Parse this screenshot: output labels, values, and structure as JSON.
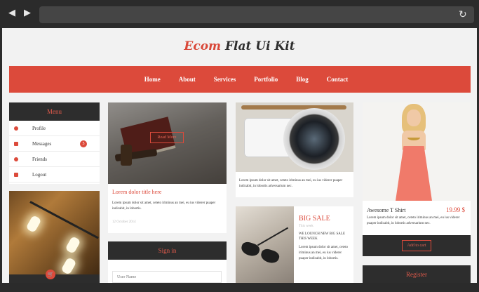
{
  "browser": {
    "back_icon": "◀",
    "forward_icon": "▶",
    "reload_icon": "↻"
  },
  "logo": {
    "accent": "Ecom",
    "rest": "Flat Ui Kit"
  },
  "nav": {
    "items": [
      "Home",
      "About",
      "Services",
      "Portfolio",
      "Blog",
      "Contact"
    ]
  },
  "menu": {
    "title": "Menu",
    "items": [
      {
        "label": "Profile",
        "icon": "user-icon"
      },
      {
        "label": "Messages",
        "icon": "envelope-icon",
        "badge": "5"
      },
      {
        "label": "Friends",
        "icon": "friends-icon"
      },
      {
        "label": "Logout",
        "icon": "logout-icon"
      }
    ]
  },
  "lamp_card": {
    "cart_icon": "🛒"
  },
  "blog_card": {
    "button": "Read More",
    "title": "Lorem dolor title here",
    "text": "Lorem ipsum dolor sit amet, ceteto iriminus an mei, eu ius viderer puaper indicabit, in lobortis.",
    "date": "12 October 2014"
  },
  "signin": {
    "title": "Sign in",
    "username_placeholder": "User Name"
  },
  "camera_card": {
    "text": "Lorem ipsum dolor sit amet, ceteto iriminus an mei, eu ius viderer puaper indicabit, in lobortis adversarium nec."
  },
  "sale_card": {
    "title": "BIG SALE",
    "subtitle": "This week",
    "promo": "WE LOUNCH NEW BIG SALE THIS WEEK",
    "text": "Lorem ipsum dolor sit amet, ceteto iriminus an mei, eu ius viderer puaper indicabit, in lobortis."
  },
  "product_card": {
    "name": "Awesome T Shirt",
    "price": "19.99 $",
    "text": "Lorem ipsum dolor sit amet, ceteto iriminus an mei, eu ius viderer puaper indicabit, in lobortis adversarium nec.",
    "button": "Add to cart"
  },
  "register": {
    "title": "Register"
  },
  "colors": {
    "accent": "#dc4a3b",
    "dark": "#2d2d2d",
    "background": "#f2f2f2"
  }
}
